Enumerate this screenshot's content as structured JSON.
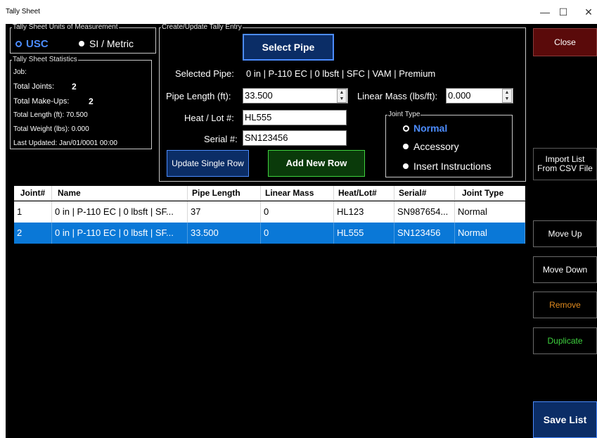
{
  "window": {
    "title": "Tally Sheet",
    "minimize": "—",
    "maximize": "☐",
    "close": "✕"
  },
  "units": {
    "legend": "Tally Sheet Units of Measurement",
    "usc": "USC",
    "si": "SI / Metric",
    "selected": "USC"
  },
  "stats": {
    "legend": "Tally Sheet Statistics",
    "job_label": "Job:",
    "job_value": "",
    "total_joints_label": "Total Joints:",
    "total_joints_value": "2",
    "total_makeups_label": "Total Make-Ups:",
    "total_makeups_value": "2",
    "total_length": "Total Length (ft): 70.500",
    "total_weight": "Total Weight (lbs): 0.000",
    "last_updated": "Last Updated:  Jan/01/0001 00:00"
  },
  "entry": {
    "legend": "Create/Update Tally Entry",
    "select_pipe": "Select Pipe",
    "selected_pipe_label": "Selected Pipe:",
    "selected_pipe_value": "0 in | P-110 EC | 0 lbsft | SFC | VAM | Premium",
    "pipe_length_label": "Pipe Length (ft):",
    "pipe_length_value": "33.500",
    "linear_mass_label": "Linear Mass (lbs/ft):",
    "linear_mass_value": "0.000",
    "heat_lot_label": "Heat / Lot #:",
    "heat_lot_value": "HL555",
    "serial_label": "Serial #:",
    "serial_value": "SN123456",
    "update_single_row": "Update Single Row",
    "add_new_row": "Add New Row",
    "joint_type": {
      "legend": "Joint Type",
      "normal": "Normal",
      "accessory": "Accessory",
      "insert_instructions": "Insert Instructions",
      "selected": "Normal"
    }
  },
  "grid": {
    "columns": [
      "Joint#",
      "Name",
      "Pipe Length",
      "Linear Mass",
      "Heat/Lot#",
      "Serial#",
      "Joint Type"
    ],
    "rows": [
      [
        "1",
        "0 in | P-110 EC | 0 lbsft | SF...",
        "37",
        "0",
        "HL123",
        "SN987654...",
        "Normal"
      ],
      [
        "2",
        "0 in | P-110 EC | 0 lbsft | SF...",
        "33.500",
        "0",
        "HL555",
        "SN123456",
        "Normal"
      ]
    ],
    "selected_row": 2
  },
  "side": {
    "close": "Close",
    "import_line1": "Import List",
    "import_line2": "From CSV File",
    "move_up": "Move Up",
    "move_down": "Move Down",
    "remove": "Remove",
    "duplicate": "Duplicate",
    "save_list": "Save List"
  },
  "colors": {
    "background": "#000000",
    "selection": "#0a78d7",
    "accent_blue": "#4c8cff",
    "close_bg": "#5a0a0a",
    "save_bg": "#0b2d66",
    "remove_text": "#e08a1e",
    "duplicate_text": "#3fd23f"
  }
}
